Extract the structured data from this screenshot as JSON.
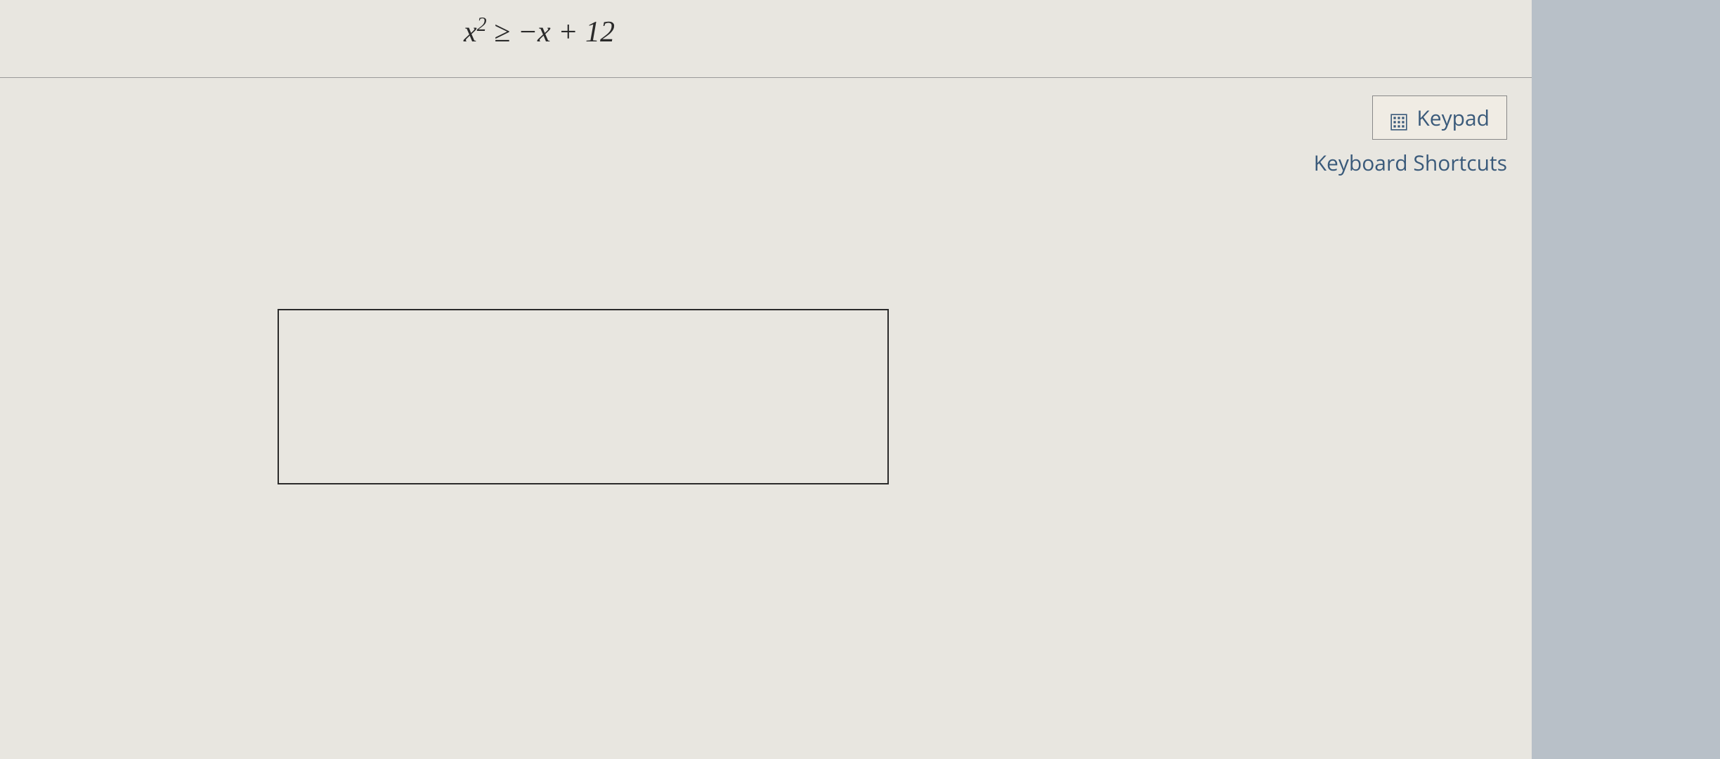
{
  "equation": {
    "lhs_var": "x",
    "lhs_exp": "2",
    "operator": "≥",
    "rhs": "−x + 12"
  },
  "tools": {
    "keypad_label": "Keypad",
    "shortcuts_label": "Keyboard Shortcuts"
  },
  "answer": {
    "value": ""
  }
}
